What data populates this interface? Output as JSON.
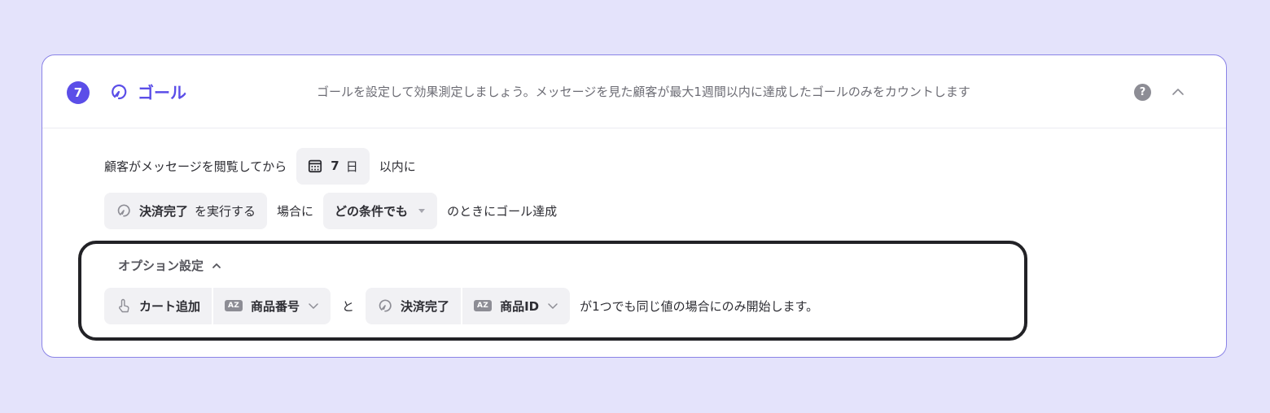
{
  "header": {
    "step_number": "7",
    "title": "ゴール",
    "description": "ゴールを設定して効果測定しましょう。メッセージを見た顧客が最大1週間以内に達成したゴールのみをカウントします",
    "help_label": "?"
  },
  "row1": {
    "prefix": "顧客がメッセージを閲覧してから",
    "days_value": "7",
    "days_unit": "日",
    "suffix": "以内に"
  },
  "row2": {
    "event_name": "決済完了",
    "event_action": "を実行する",
    "middle_text": "場合に",
    "condition_select": "どの条件でも",
    "suffix": "のときにゴール達成"
  },
  "options": {
    "title": "オプション設定",
    "left_event": "カート追加",
    "left_field_badge": "AZ",
    "left_field": "商品番号",
    "connector": "と",
    "right_event": "決済完了",
    "right_field_badge": "AZ",
    "right_field": "商品ID",
    "suffix": "が1つでも同じ値の場合にのみ開始します。"
  },
  "icons": {
    "goal": "goal-icon",
    "help": "help-icon",
    "collapse": "chevron-up-icon",
    "calendar": "calendar-icon",
    "touch": "touch-icon"
  },
  "colors": {
    "accent": "#5b4ee8",
    "background": "#e4e3fb",
    "card_border": "#8a83e6",
    "chip_bg": "#f1f1f4"
  }
}
